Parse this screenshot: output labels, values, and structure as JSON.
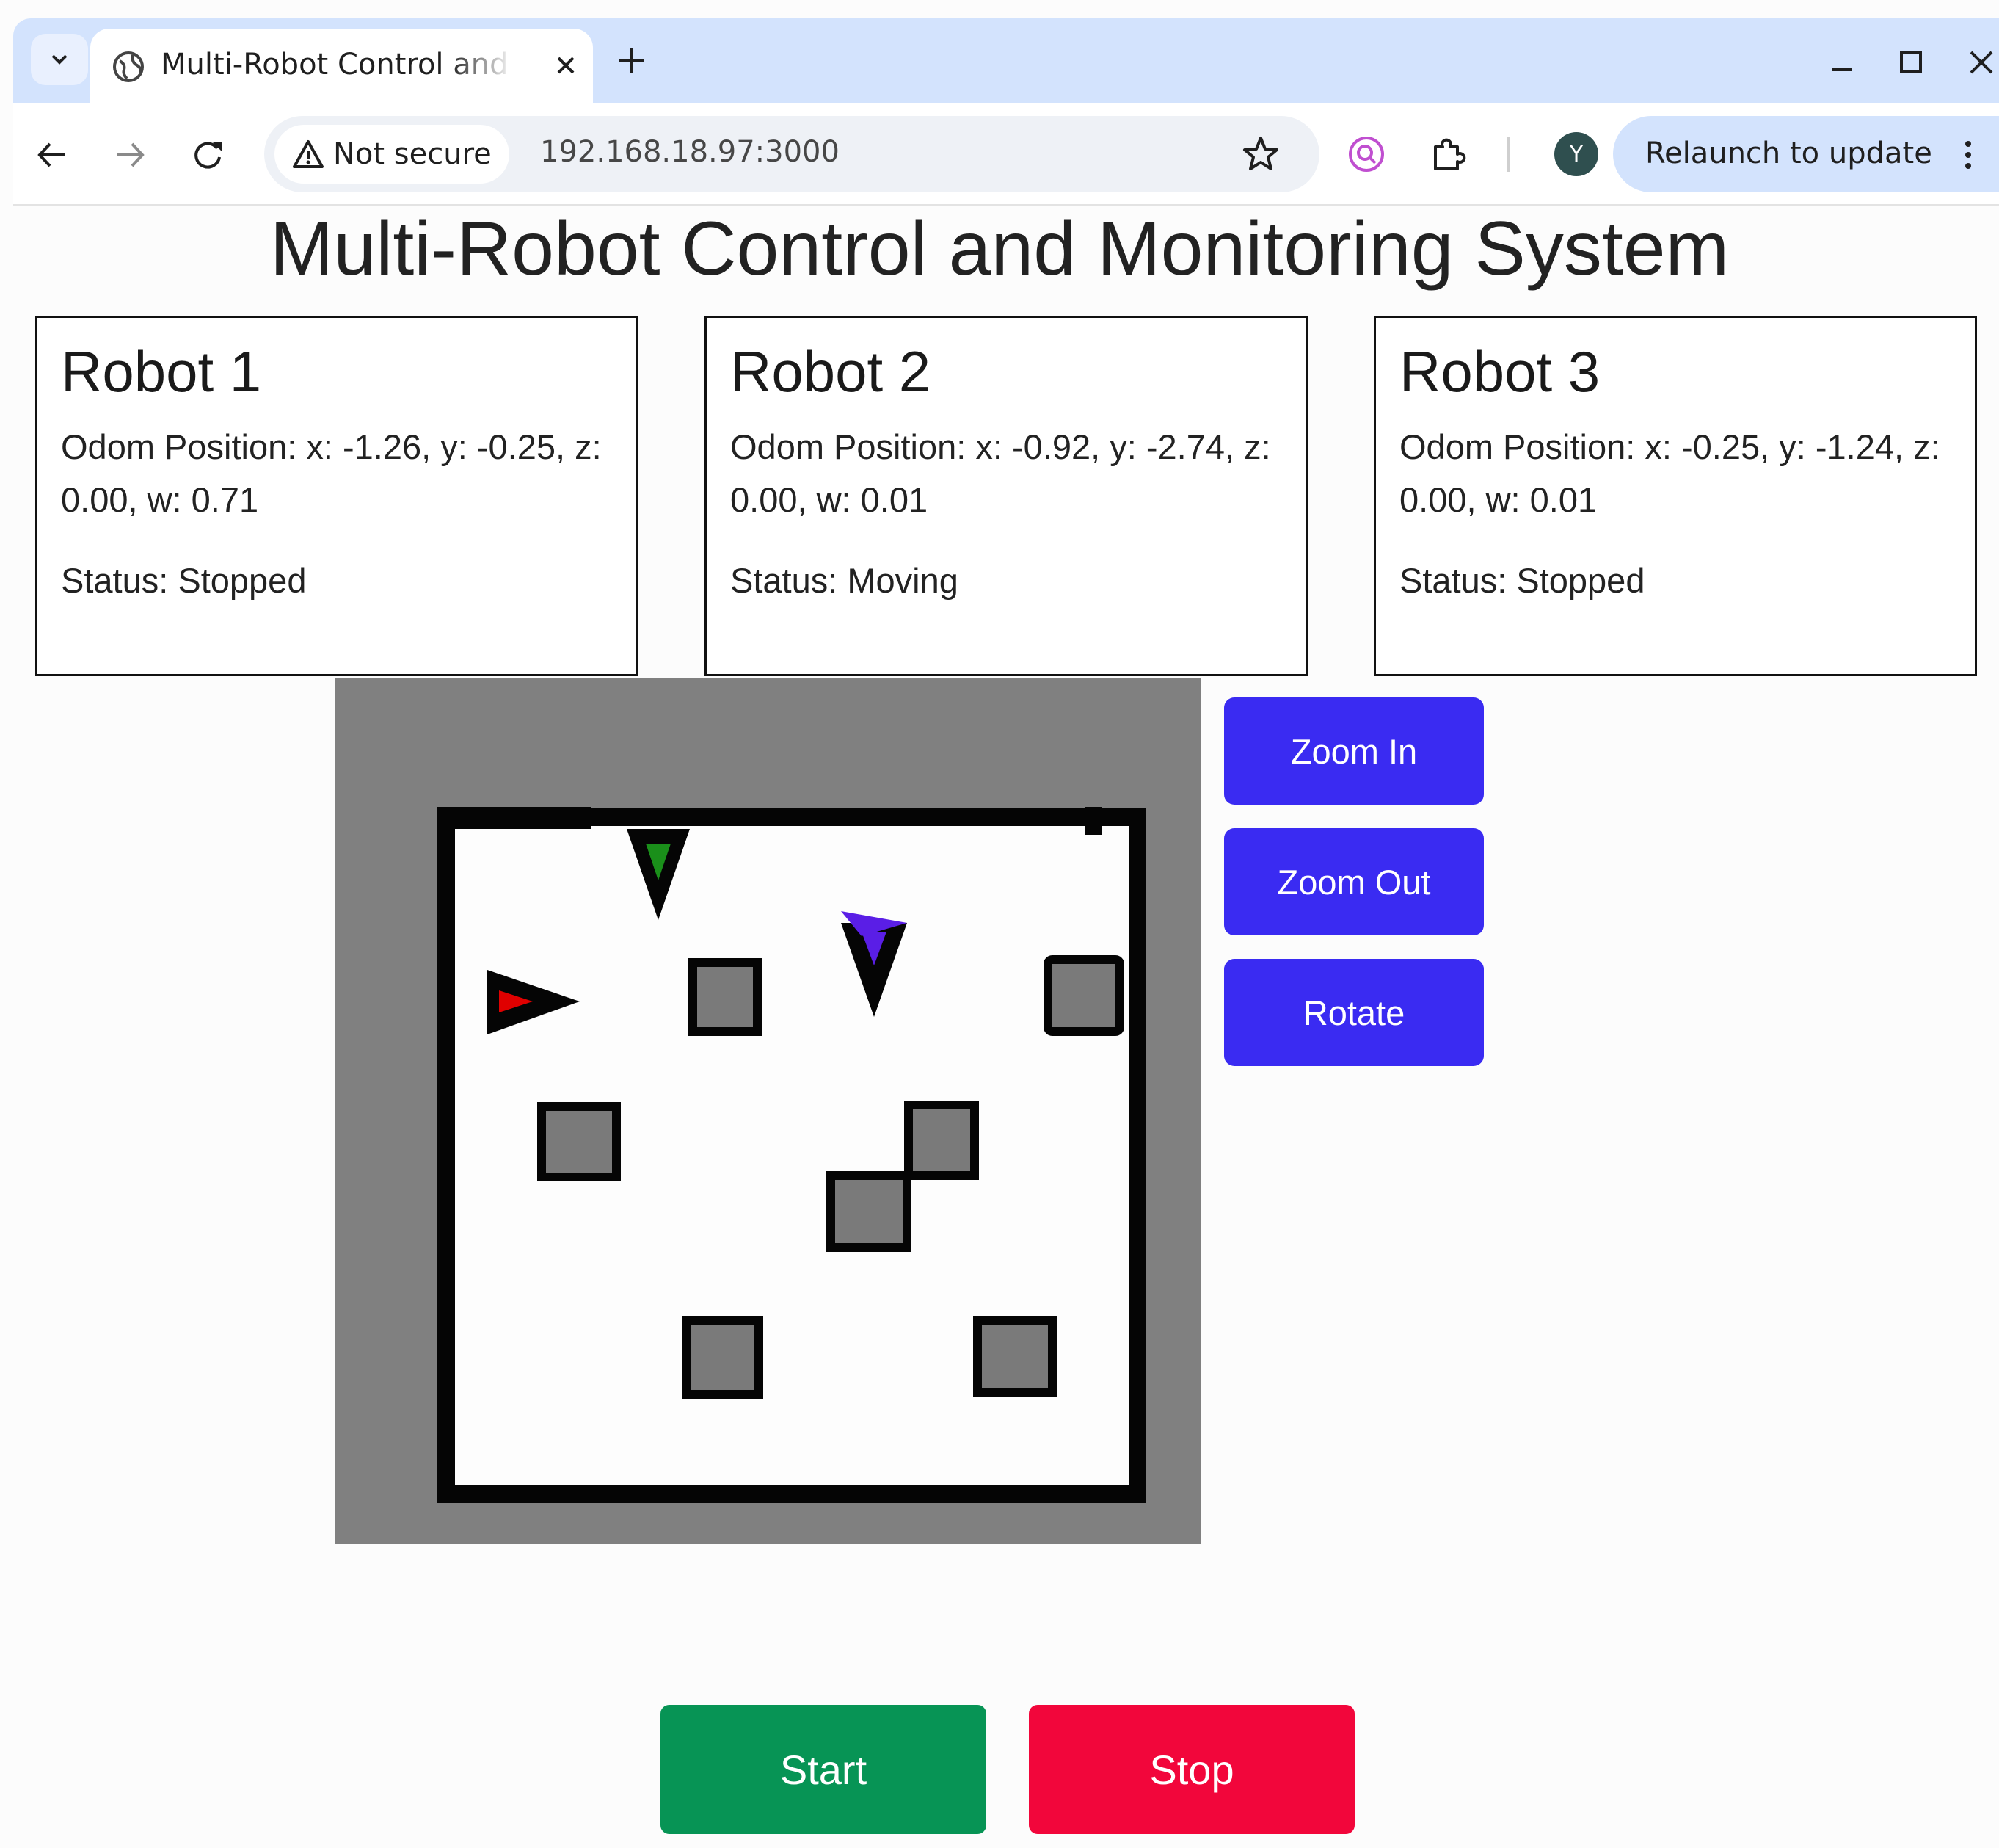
{
  "browser": {
    "tab_title": "Multi-Robot Control and Monitoring System",
    "security_label": "Not secure",
    "url": "192.168.18.97:3000",
    "profile_initial": "Y",
    "relaunch_label": "Relaunch to update"
  },
  "page": {
    "title": "Multi-Robot Control and Monitoring System"
  },
  "robots": [
    {
      "name": "Robot 1",
      "odom": "Odom Position: x: -1.26, y: -0.25, z: 0.00, w: 0.71",
      "status": "Status: Stopped",
      "color": "#e00000"
    },
    {
      "name": "Robot 2",
      "odom": "Odom Position: x: -0.92, y: -2.74, z: 0.00, w: 0.01",
      "status": "Status: Moving",
      "color": "#1a8f1a"
    },
    {
      "name": "Robot 3",
      "odom": "Odom Position: x: -0.25, y: -1.24, z: 0.00, w: 0.01",
      "status": "Status: Stopped",
      "color": "#5a1ee6"
    }
  ],
  "map_controls": {
    "zoom_in": "Zoom In",
    "zoom_out": "Zoom Out",
    "rotate": "Rotate"
  },
  "actions": {
    "start": "Start",
    "stop": "Stop"
  },
  "colors": {
    "control_button": "#3a2bf2",
    "start_button": "#079455",
    "stop_button": "#f2063b",
    "map_unknown": "#808080"
  },
  "icons": [
    "tab-search-icon",
    "globe-icon",
    "close-icon",
    "new-tab-icon",
    "minimize-icon",
    "maximize-icon",
    "window-close-icon",
    "back-icon",
    "forward-icon",
    "reload-icon",
    "warning-icon",
    "star-icon",
    "extension-lens-icon",
    "puzzle-icon",
    "kebab-menu-icon"
  ]
}
